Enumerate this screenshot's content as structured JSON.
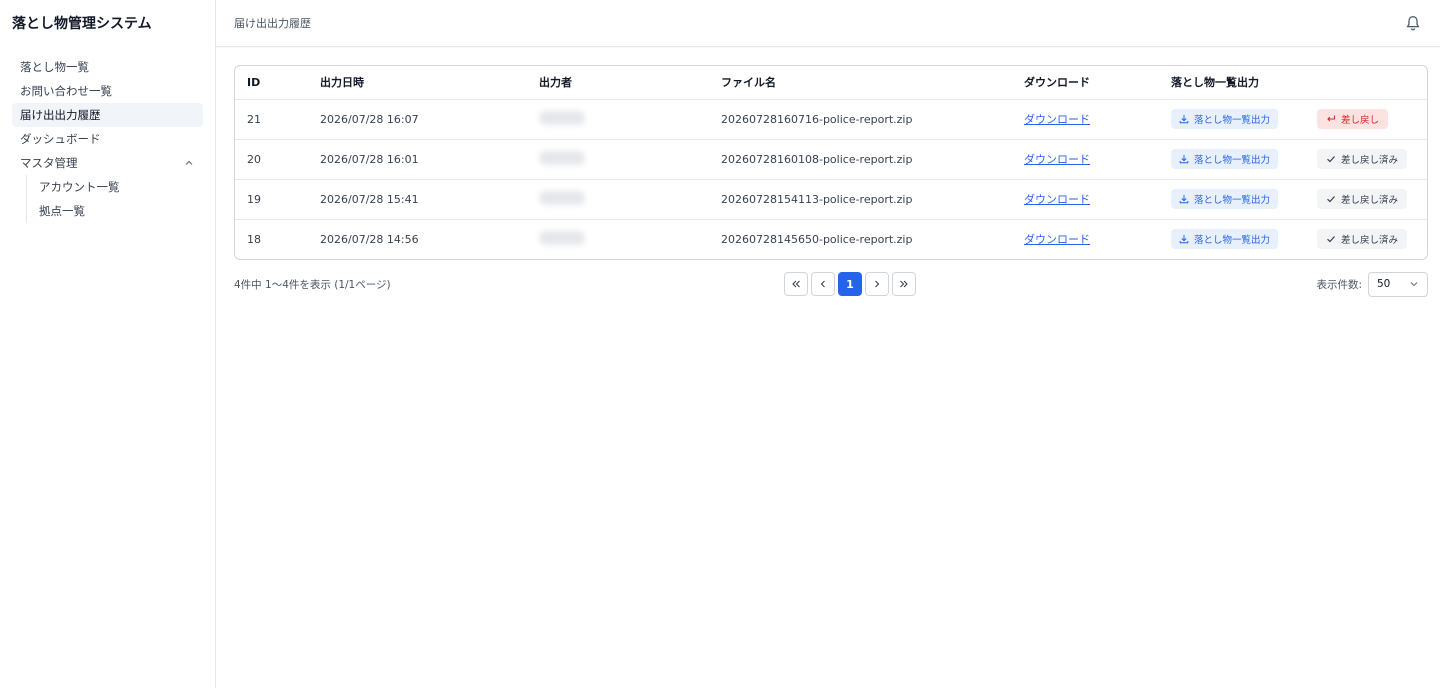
{
  "app": {
    "title": "落とし物管理システム"
  },
  "sidebar": {
    "items": [
      {
        "label": "落とし物一覧"
      },
      {
        "label": "お問い合わせ一覧"
      },
      {
        "label": "届け出出力履歴",
        "active": true
      },
      {
        "label": "ダッシュボード"
      }
    ],
    "group": {
      "label": "マスタ管理",
      "expanded": true,
      "icon": "chevron-up-icon",
      "children": [
        {
          "label": "アカウント一覧"
        },
        {
          "label": "拠点一覧"
        }
      ]
    }
  },
  "header": {
    "breadcrumb": "届け出出力履歴",
    "bell_icon": "bell-icon"
  },
  "table": {
    "columns": [
      "ID",
      "出力日時",
      "出力者",
      "ファイル名",
      "ダウンロード",
      "落とし物一覧出力",
      ""
    ],
    "rows": [
      {
        "id": "21",
        "datetime": "2026/07/28 16:07",
        "exporter": "",
        "file": "20260728160716-police-report.zip",
        "download": "ダウンロード",
        "export_label": "落とし物一覧出力",
        "action": "差し戻し",
        "action_state": "revert"
      },
      {
        "id": "20",
        "datetime": "2026/07/28 16:01",
        "exporter": "",
        "file": "20260728160108-police-report.zip",
        "download": "ダウンロード",
        "export_label": "落とし物一覧出力",
        "action": "差し戻し済み",
        "action_state": "reverted"
      },
      {
        "id": "19",
        "datetime": "2026/07/28 15:41",
        "exporter": "",
        "file": "20260728154113-police-report.zip",
        "download": "ダウンロード",
        "export_label": "落とし物一覧出力",
        "action": "差し戻し済み",
        "action_state": "reverted"
      },
      {
        "id": "18",
        "datetime": "2026/07/28 14:56",
        "exporter": "",
        "file": "20260728145650-police-report.zip",
        "download": "ダウンロード",
        "export_label": "落とし物一覧出力",
        "action": "差し戻し済み",
        "action_state": "reverted"
      }
    ]
  },
  "pagination": {
    "summary": "4件中 1〜4件を表示 (1/1ページ)",
    "current_page": "1",
    "per_page_label": "表示件数:",
    "per_page_value": "50"
  },
  "colors": {
    "accent": "#2563eb",
    "danger": "#dc2626",
    "danger_bg": "#fde2e2",
    "accent_bg": "#e8f0fe"
  }
}
